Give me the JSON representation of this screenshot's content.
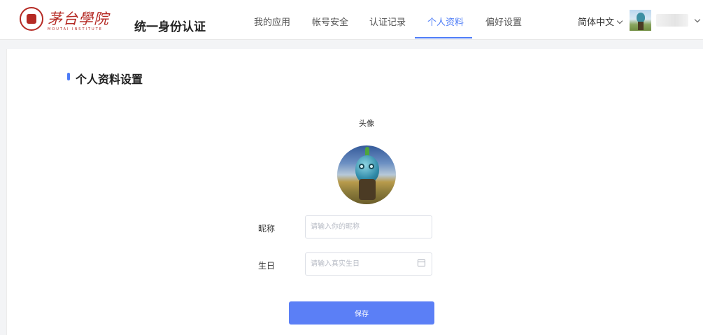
{
  "header": {
    "logo": {
      "name": "茅台學院",
      "subtitle": "MOUTAI INSTITUTE"
    },
    "app_title": "统一身份认证",
    "nav": [
      {
        "label": "我的应用",
        "active": false
      },
      {
        "label": "帐号安全",
        "active": false
      },
      {
        "label": "认证记录",
        "active": false
      },
      {
        "label": "个人资料",
        "active": true
      },
      {
        "label": "偏好设置",
        "active": false
      }
    ],
    "language": "简体中文",
    "accent_color": "#4d7cf7"
  },
  "main": {
    "section_title": "个人资料设置",
    "avatar_label": "头像",
    "form": {
      "nickname": {
        "label": "昵称",
        "value": "",
        "placeholder": "请输入你的昵称"
      },
      "birthday": {
        "label": "生日",
        "value": "",
        "placeholder": "请输入真实生日"
      }
    },
    "save_label": "保存"
  }
}
